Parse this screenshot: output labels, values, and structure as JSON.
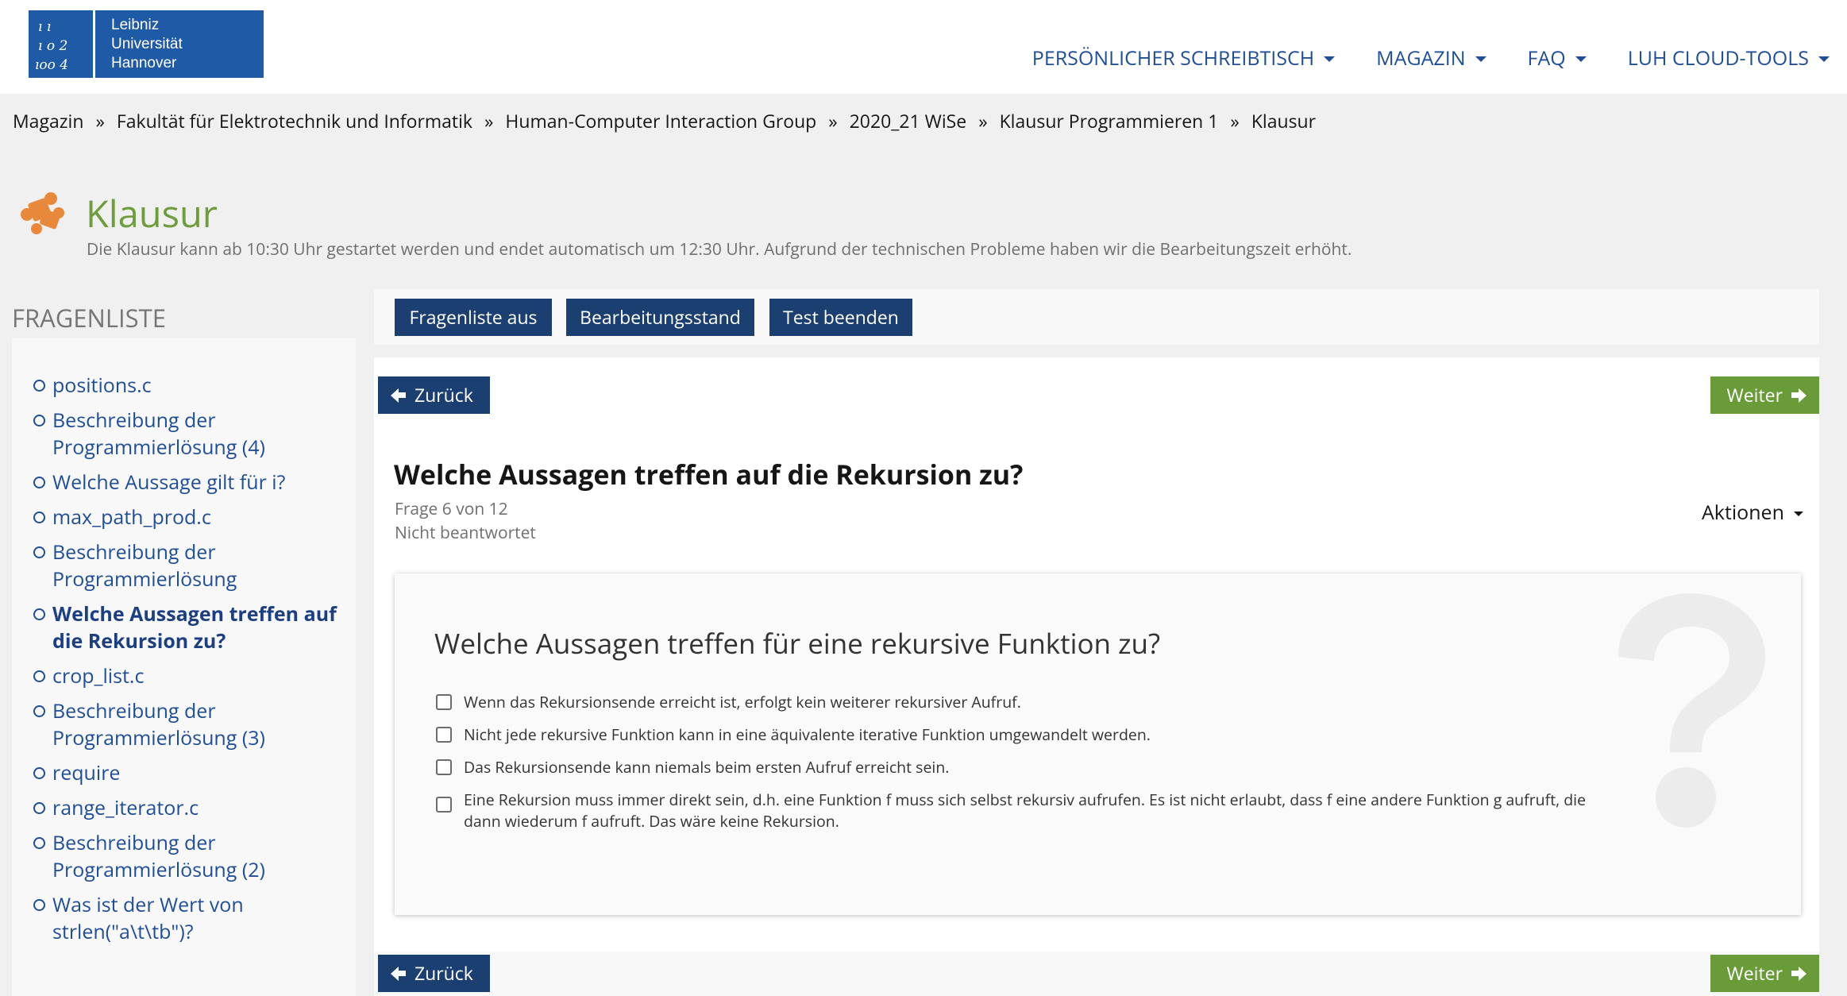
{
  "header": {
    "logo_lines": [
      "Leibniz",
      "Universität",
      "Hannover"
    ],
    "nav": [
      {
        "label": "PERSÖNLICHER SCHREIBTISCH"
      },
      {
        "label": "MAGAZIN"
      },
      {
        "label": "FAQ"
      },
      {
        "label": "LUH CLOUD-TOOLS"
      }
    ]
  },
  "breadcrumb": [
    "Magazin",
    "Fakultät für Elektrotechnik und Informatik",
    "Human-Computer Interaction Group",
    "2020_21 WiSe",
    "Klausur Programmieren 1",
    "Klausur"
  ],
  "breadcrumb_separator": "»",
  "page": {
    "title": "Klausur",
    "description": "Die Klausur kann ab 10:30 Uhr gestartet werden und endet automatisch um 12:30 Uhr. Aufgrund der technischen Probleme haben wir die Bearbeitungszeit erhöht."
  },
  "sidebar": {
    "heading": "FRAGENLISTE",
    "items": [
      {
        "label": "positions.c",
        "active": false
      },
      {
        "label": "Beschreibung der Programmierlösung (4)",
        "active": false
      },
      {
        "label": "Welche Aussage gilt für i?",
        "active": false
      },
      {
        "label": "max_path_prod.c",
        "active": false
      },
      {
        "label": "Beschreibung der Programmierlösung",
        "active": false
      },
      {
        "label": "Welche Aussagen treffen auf die Rekursion zu?",
        "active": true
      },
      {
        "label": "crop_list.c",
        "active": false
      },
      {
        "label": "Beschreibung der Programmierlösung (3)",
        "active": false
      },
      {
        "label": "require",
        "active": false
      },
      {
        "label": "range_iterator.c",
        "active": false
      },
      {
        "label": "Beschreibung der Programmierlösung (2)",
        "active": false
      },
      {
        "label": "Was ist der Wert von strlen(\"a\\t\\tb\")?",
        "active": false
      }
    ]
  },
  "toolbar": {
    "toggle_list": "Fragenliste aus",
    "progress": "Bearbeitungsstand",
    "finish": "Test beenden"
  },
  "navigation": {
    "back": "Zurück",
    "next": "Weiter"
  },
  "question": {
    "title": "Welche Aussagen treffen auf die Rekursion zu?",
    "counter": "Frage 6 von 12",
    "status": "Nicht beantwortet",
    "actions": "Aktionen",
    "text": "Welche Aussagen treffen für eine rekursive Funktion zu?",
    "answers": [
      {
        "text": "Wenn das Rekursionsende erreicht ist, erfolgt kein weiterer rekursiver Aufruf.",
        "checked": false
      },
      {
        "text": "Nicht jede rekursive Funktion kann in eine äquivalente iterative Funktion umgewandelt werden.",
        "checked": false
      },
      {
        "text": "Das Rekursionsende kann niemals beim ersten Aufruf erreicht sein.",
        "checked": false
      },
      {
        "text": "Eine Rekursion muss immer direkt sein, d.h. eine Funktion f muss sich selbst rekursiv aufrufen. Es ist nicht erlaubt, dass f eine andere Funktion g aufruft, die dann wiederum f aufruft. Das wäre keine Rekursion.",
        "checked": false
      }
    ]
  },
  "colors": {
    "brand_blue": "#1f5aa6",
    "nav_blue": "#1f4e98",
    "button_dark_blue": "#1c3f72",
    "next_green": "#6a9b39",
    "title_green": "#6e9d3b",
    "puzzle_orange": "#e8883a"
  }
}
